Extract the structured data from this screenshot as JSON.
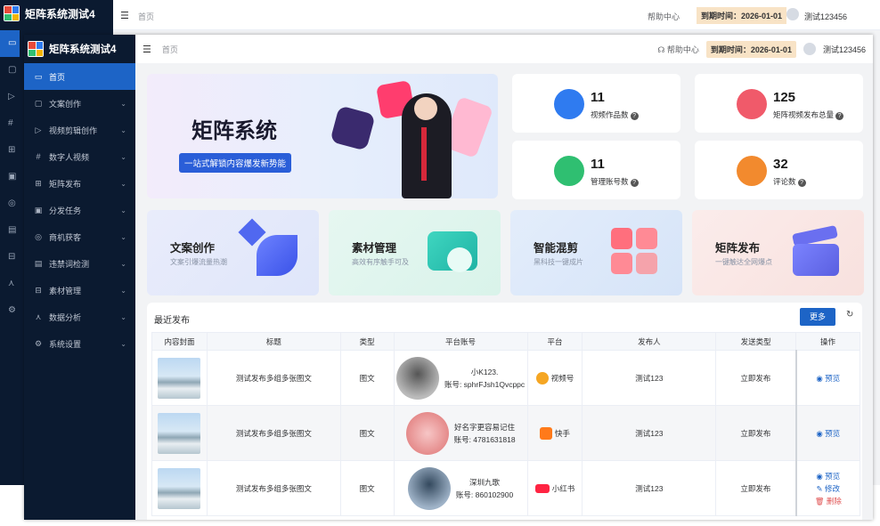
{
  "app": {
    "title": "矩阵系统测试4"
  },
  "header": {
    "breadcrumb": "首页",
    "help": "帮助中心",
    "expire": "到期时间：2026-01-01",
    "user": "测试123456"
  },
  "sidebar": {
    "items": [
      {
        "label": "首页",
        "icon": "monitor-icon"
      },
      {
        "label": "文案创作",
        "icon": "file-icon"
      },
      {
        "label": "视频剪辑创作",
        "icon": "video-icon"
      },
      {
        "label": "数字人视频",
        "icon": "digital-human-icon"
      },
      {
        "label": "矩阵发布",
        "icon": "grid-icon"
      },
      {
        "label": "分发任务",
        "icon": "task-icon"
      },
      {
        "label": "商机获客",
        "icon": "target-icon"
      },
      {
        "label": "违禁词检测",
        "icon": "lock-icon"
      },
      {
        "label": "素材管理",
        "icon": "folder-icon"
      },
      {
        "label": "数据分析",
        "icon": "chart-icon"
      },
      {
        "label": "系统设置",
        "icon": "gear-icon"
      }
    ]
  },
  "banner": {
    "title": "矩阵系统",
    "subtitle": "一站式解锁内容爆发新势能"
  },
  "stats": [
    {
      "value": "11",
      "label": "视频作品数",
      "color": "#2f7bf0"
    },
    {
      "value": "125",
      "label": "矩阵视频发布总量",
      "color": "#f05a6a"
    },
    {
      "value": "11",
      "label": "管理账号数",
      "color": "#2fbf71"
    },
    {
      "value": "32",
      "label": "评论数",
      "color": "#f28a2e"
    }
  ],
  "features": [
    {
      "title": "文案创作",
      "subtitle": "文案引爆流量热潮"
    },
    {
      "title": "素材管理",
      "subtitle": "高效有序触手可及"
    },
    {
      "title": "智能混剪",
      "subtitle": "黑科技一键成片"
    },
    {
      "title": "矩阵发布",
      "subtitle": "一键触达全网爆点"
    }
  ],
  "recent": {
    "title": "最近发布",
    "more": "更多",
    "columns": [
      "内容封面",
      "标题",
      "类型",
      "平台账号",
      "平台",
      "发布人",
      "发送类型",
      "操作"
    ],
    "rows": [
      {
        "title": "测试发布多组多张图文",
        "type": "图文",
        "account_name": "小K123.",
        "account_id": "账号: sphrFJsh1Qvcppc",
        "platform": "视频号",
        "publisher": "测试123",
        "send_type": "立即发布",
        "ops": [
          "预览"
        ]
      },
      {
        "title": "测试发布多组多张图文",
        "type": "图文",
        "account_name": "好名字更容易记住",
        "account_id": "账号: 4781631818",
        "platform": "快手",
        "publisher": "测试123",
        "send_type": "立即发布",
        "ops": [
          "预览"
        ]
      },
      {
        "title": "测试发布多组多张图文",
        "type": "图文",
        "account_name": "深圳九歌",
        "account_id": "账号: 860102900",
        "platform": "小红书",
        "publisher": "测试123",
        "send_type": "立即发布",
        "ops": [
          "预览",
          "修改",
          "删除"
        ]
      }
    ]
  }
}
